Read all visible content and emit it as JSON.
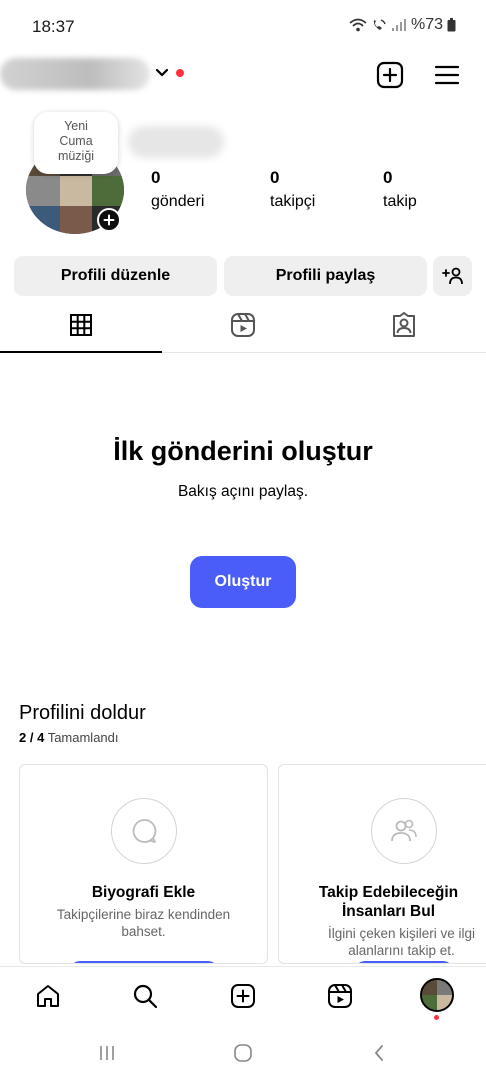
{
  "status_bar": {
    "time": "18:37",
    "battery": "%73"
  },
  "header": {
    "create_icon": "plus-square-icon",
    "menu_icon": "hamburger-menu-icon"
  },
  "profile": {
    "note_lines": [
      "Yeni",
      "Cuma",
      "müziği"
    ],
    "stats": [
      {
        "count": "0",
        "label": "gönderi"
      },
      {
        "count": "0",
        "label": "takipçi"
      },
      {
        "count": "0",
        "label": "takip"
      }
    ],
    "edit_profile_label": "Profili düzenle",
    "share_profile_label": "Profili paylaş"
  },
  "tabs": [
    {
      "icon": "grid-icon",
      "active": true
    },
    {
      "icon": "reels-icon",
      "active": false
    },
    {
      "icon": "tagged-icon",
      "active": false
    }
  ],
  "empty_state": {
    "title": "İlk gönderini oluştur",
    "subtitle": "Bakış açını paylaş.",
    "button_label": "Oluştur"
  },
  "complete_profile": {
    "title": "Profilini doldur",
    "progress_count": "2 / 4",
    "progress_label": "Tamamlandı",
    "cards": [
      {
        "title": "Biyografi Ekle",
        "description": "Takipçilerine biraz kendinden bahset.",
        "icon": "speech-bubble-icon"
      },
      {
        "title": "Takip Edebileceğin İnsanları Bul",
        "description": "İlgini çeken kişileri ve ilgi alanlarını takip et.",
        "icon": "people-icon"
      }
    ]
  },
  "bottom_nav": [
    "home-icon",
    "search-icon",
    "create-icon",
    "reels-icon",
    "profile-avatar"
  ],
  "colors": {
    "accent": "#4a5df9",
    "notification": "#ff3040",
    "button_gray": "#efefef"
  }
}
